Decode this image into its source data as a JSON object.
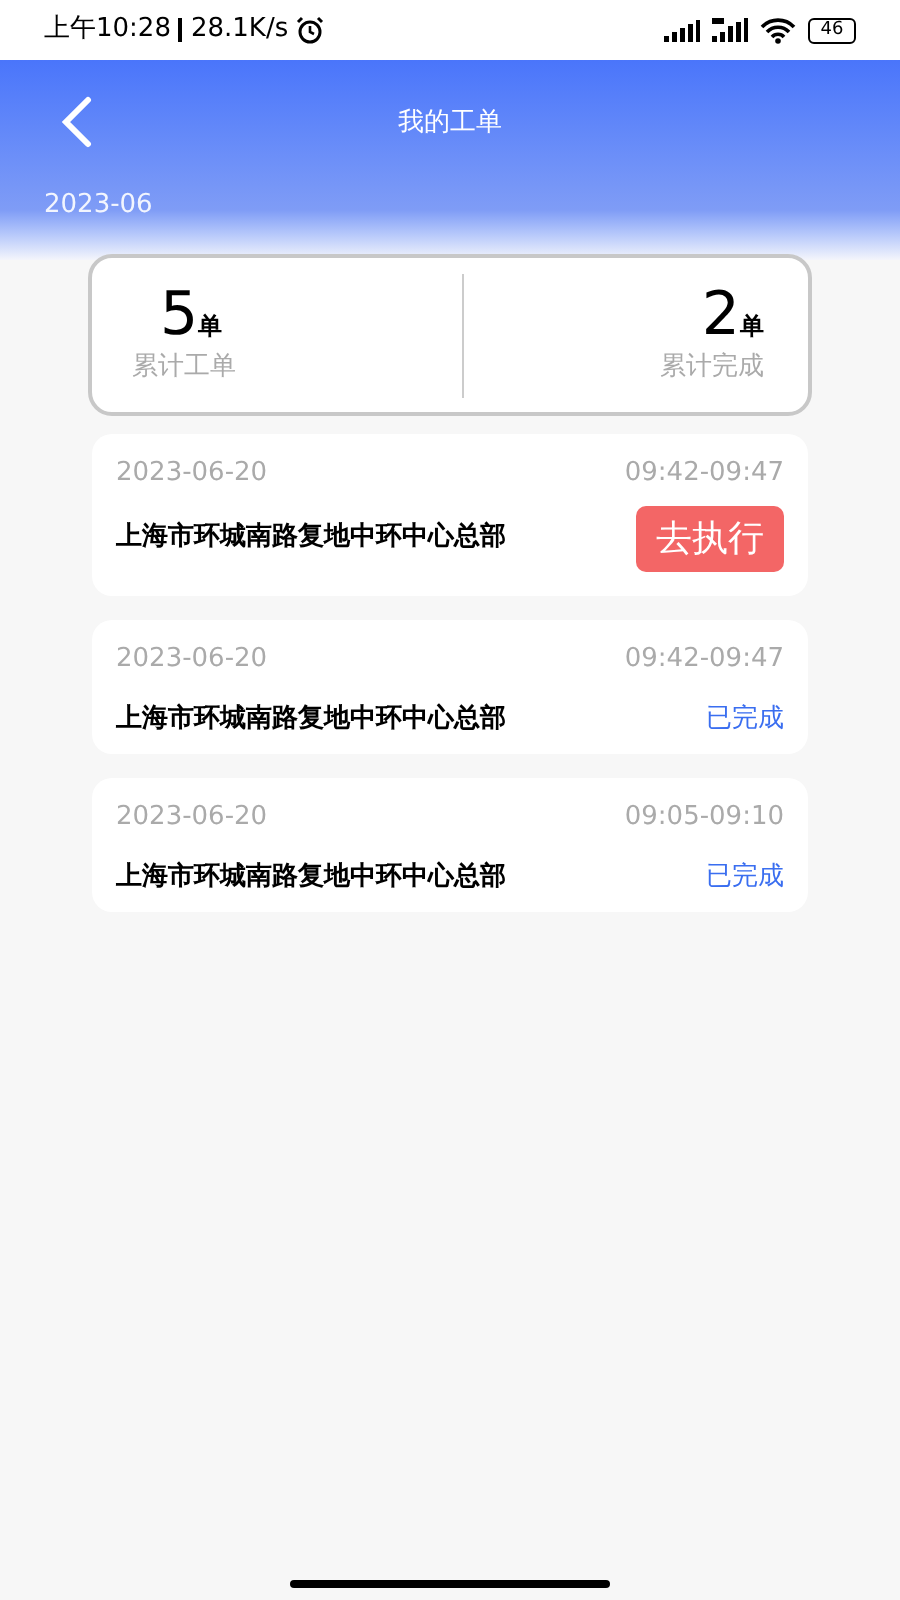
{
  "status_bar": {
    "time": "上午10:28",
    "speed": "28.1K/s",
    "battery": "46"
  },
  "header": {
    "title": "我的工单",
    "month": "2023-06"
  },
  "summary": [
    {
      "value": "5",
      "unit": "单",
      "label": "累计工单"
    },
    {
      "value": "2",
      "unit": "单",
      "label": "累计完成"
    }
  ],
  "orders": [
    {
      "date": "2023-06-20",
      "time": "09:42-09:47",
      "address": "上海市环城南路复地中环中心总部",
      "kind": "pending",
      "action": "去执行"
    },
    {
      "date": "2023-06-20",
      "time": "09:42-09:47",
      "address": "上海市环城南路复地中环中心总部",
      "kind": "done",
      "action": "已完成"
    },
    {
      "date": "2023-06-20",
      "time": "09:05-09:10",
      "address": "上海市环城南路复地中环中心总部",
      "kind": "done",
      "action": "已完成"
    }
  ]
}
